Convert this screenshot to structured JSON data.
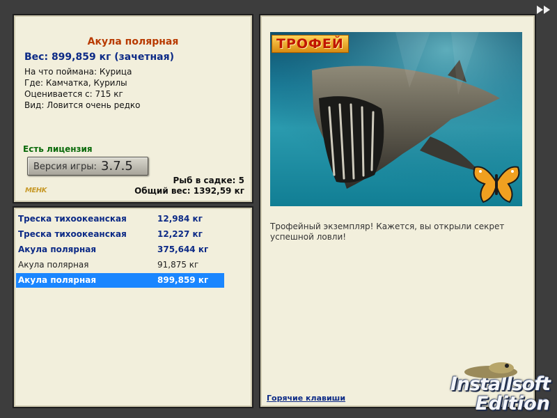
{
  "fish_info": {
    "title": "Акула полярная",
    "weight": "Вес: 899,859 кг (зачетная)",
    "bait": "На что поймана: Курица",
    "location": "Где: Камчатка, Курилы",
    "value": "Оценивается с: 715 кг",
    "rarity": "Вид: Ловится очень редко",
    "license": "Есть лицензия",
    "version_label": "Версия игры:",
    "version_number": "3.7.5",
    "fish_in_keepnet": "Рыб в садке: 5",
    "total_weight": "Общий вес: 1392,59 кг",
    "logo_text": "MEHK"
  },
  "catch_list": [
    {
      "name": "Треска тихоокеанская",
      "weight": "12,984 кг",
      "style": "bold"
    },
    {
      "name": "Треска тихоокеанская",
      "weight": "12,227 кг",
      "style": "bold"
    },
    {
      "name": "Акула полярная",
      "weight": "375,644 кг",
      "style": "bold"
    },
    {
      "name": "Акула полярная",
      "weight": "91,875 кг",
      "style": "normal"
    },
    {
      "name": "Акула полярная",
      "weight": "899,859 кг",
      "style": "selected"
    }
  ],
  "trophy": {
    "label": "ТРОФЕЙ",
    "text": "Трофейный экземпляр! Кажется, вы открыли секрет успешной ловли!",
    "hotkeys_link": "Горячие клавиши"
  },
  "brand": {
    "line1": "Installsoft",
    "line2": "Edition"
  },
  "icons": {
    "forward": "fast-forward-icon",
    "butterfly": "butterfly-icon"
  },
  "colors": {
    "panel_bg": "#f2efdc",
    "title": "#b83a00",
    "highlight_blue": "#0c2a86",
    "selected_row": "#1a86ff",
    "license_green": "#0a6a0a"
  }
}
